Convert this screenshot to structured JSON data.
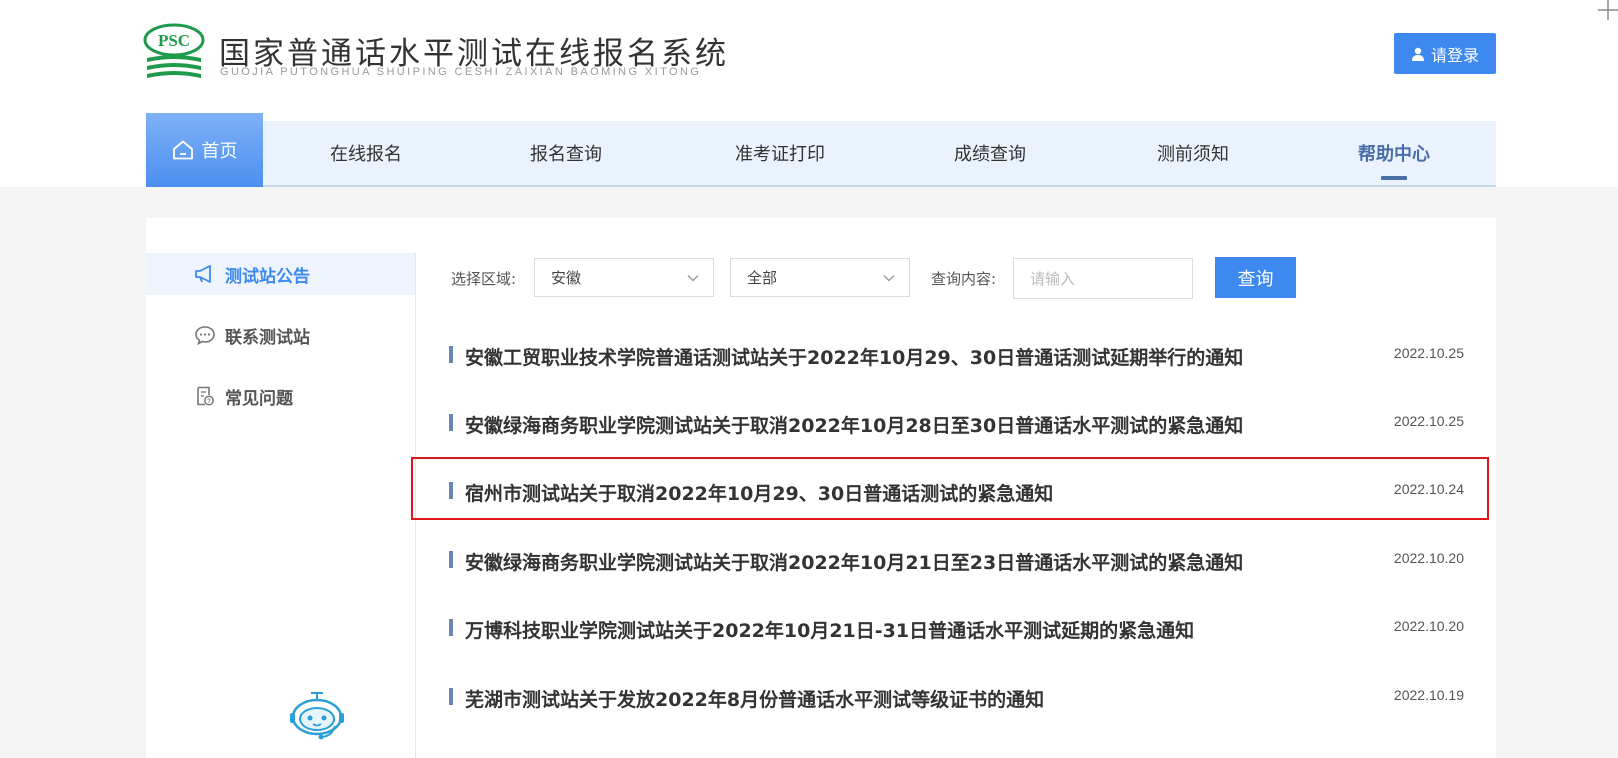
{
  "header": {
    "logo_badge": "PSC",
    "title": "国家普通话水平测试在线报名系统",
    "subtitle": "GUOJIA PUTONGHUA SHUIPING CESHI ZAIXIAN BAOMING XITONG",
    "login_label": "请登录"
  },
  "nav": {
    "home": "首页",
    "items": [
      "在线报名",
      "报名查询",
      "准考证打印",
      "成绩查询",
      "测前须知",
      "帮助中心"
    ],
    "active": "帮助中心"
  },
  "sidebar": {
    "items": [
      "测试站公告",
      "联系测试站",
      "常见问题"
    ],
    "active": "测试站公告"
  },
  "filters": {
    "region_label": "选择区域:",
    "province": "安徽",
    "city": "全部",
    "content_label": "查询内容:",
    "search_placeholder": "请输入",
    "query_button": "查询"
  },
  "notices": [
    {
      "title": "安徽工贸职业技术学院普通话测试站关于2022年10月29、30日普通话测试延期举行的通知",
      "date": "2022.10.25"
    },
    {
      "title": "安徽绿海商务职业学院测试站关于取消2022年10月28日至30日普通话水平测试的紧急通知",
      "date": "2022.10.25"
    },
    {
      "title": "宿州市测试站关于取消2022年10月29、30日普通话测试的紧急通知",
      "date": "2022.10.24"
    },
    {
      "title": "安徽绿海商务职业学院测试站关于取消2022年10月21日至23日普通话水平测试的紧急通知",
      "date": "2022.10.20"
    },
    {
      "title": "万博科技职业学院测试站关于2022年10月21日-31日普通话水平测试延期的紧急通知",
      "date": "2022.10.20"
    },
    {
      "title": "芜湖市测试站关于发放2022年8月份普通话水平测试等级证书的通知",
      "date": "2022.10.19"
    }
  ],
  "colors": {
    "primary": "#3d89f0",
    "nav_bg": "#e9f2fd",
    "active_nav": "#4a6ea8",
    "highlight": "#e0161f",
    "logo_green": "#1f9a4c"
  }
}
